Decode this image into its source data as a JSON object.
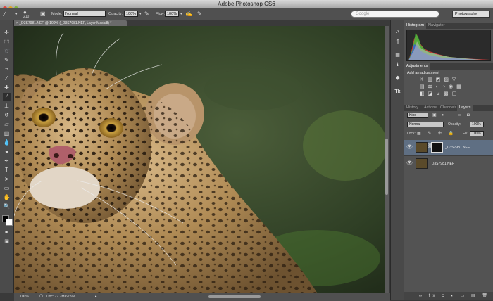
{
  "app": {
    "title": "Adobe Photoshop CS6"
  },
  "options_bar": {
    "brush_size": "210",
    "mode_label": "Mode:",
    "mode_value": "Normal",
    "opacity_label": "Opacity:",
    "opacity_value": "100%",
    "flow_label": "Flow:",
    "flow_value": "100%",
    "search_placeholder": "Google",
    "workspace": "Photography"
  },
  "document": {
    "tab_label": "_D3S7981.NEF @ 100% (_D3S7981.NEF, Layer Mask/8) *",
    "tab_close": "×"
  },
  "status_bar": {
    "zoom": "100%",
    "doc_info": "Doc: 27.7M/62.9M"
  },
  "panels": {
    "top_tabs": [
      "Histogram",
      "Navigator"
    ],
    "adjustments_tab": "Adjustments",
    "adjustments_title": "Add an adjustment",
    "adjustment_icons_row1": "☀ ▥ ◩ ▨ ▽",
    "adjustment_icons_row2": "▤ ⚖ ◐ ◑ ◉ ▦",
    "adjustment_icons_row3": "◧ ◪ ⊿ ▩ ▢",
    "layer_tabs": [
      "History",
      "Actions",
      "Channels",
      "Layers"
    ],
    "filter_kind": "Kind",
    "blend_mode": "Normal",
    "opacity_label": "Opacity:",
    "opacity_value": "100%",
    "lock_label": "Lock:",
    "fill_label": "Fill:",
    "fill_value": "100%",
    "layers": [
      {
        "name": "_D3S7981.NEF",
        "selected": true,
        "has_mask": true
      },
      {
        "name": "_D3S7981.NEF",
        "selected": false,
        "has_mask": false
      }
    ],
    "footer_icons": "∞ fx ◘ ◐ ▭ ▤ 🗑"
  },
  "colors": {
    "accent_selected_layer": "#5f6f83",
    "panel_bg": "#535353"
  }
}
